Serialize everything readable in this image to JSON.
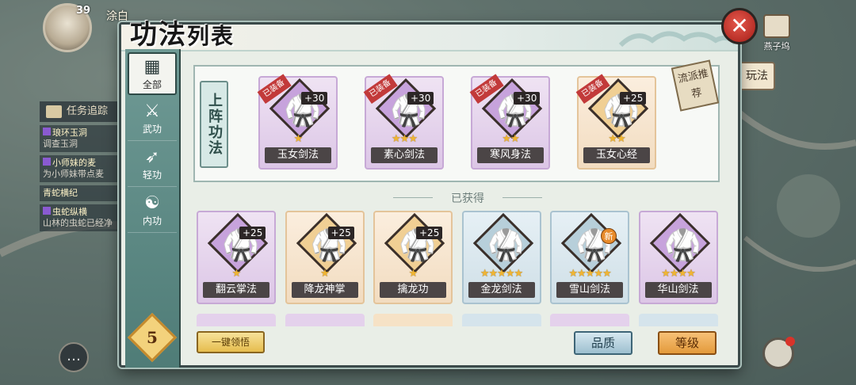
{
  "player": {
    "level": "39",
    "name": "涂白"
  },
  "hud": {
    "top_right_label": "燕子坞",
    "side_tab_label": "玩法",
    "quest_header": "任务追踪",
    "quests": [
      {
        "title": "琅环玉洞",
        "sub": "调查玉洞"
      },
      {
        "title": "小师妹的麦",
        "sub": "为小师妹带点麦"
      },
      {
        "title": "青蛇横纪",
        "sub": ""
      },
      {
        "title": "虫蛇纵横",
        "sub": "山林的虫蛇已经净"
      }
    ]
  },
  "dialog": {
    "title_main": "功法",
    "title_small": "列表",
    "close_label": "✕",
    "equipped_section_label": "上阵功法",
    "recommend_label": "流派推荐",
    "obtained_label": "已获得",
    "level_badge": "5",
    "buttons": {
      "claim_all": "一键领悟",
      "quality": "品质",
      "level": "等级"
    }
  },
  "sidebar": [
    {
      "label": "全部",
      "icon": "grid-icon",
      "glyph": "▦",
      "active": true
    },
    {
      "label": "武功",
      "icon": "sword-icon",
      "glyph": "⚔",
      "active": false
    },
    {
      "label": "轻功",
      "icon": "feather-icon",
      "glyph": "➶",
      "active": false
    },
    {
      "label": "内功",
      "icon": "meditation-icon",
      "glyph": "☯",
      "active": false
    }
  ],
  "equipped": [
    {
      "name": "玉女剑法",
      "bonus": "+30",
      "stars": "★",
      "tag": "已装备",
      "rarity": "purple"
    },
    {
      "name": "素心剑法",
      "bonus": "+30",
      "stars": "★★★",
      "tag": "已装备",
      "rarity": "purple"
    },
    {
      "name": "寒风身法",
      "bonus": "+30",
      "stars": "★★",
      "tag": "已装备",
      "rarity": "purple"
    },
    {
      "name": "玉女心经",
      "bonus": "+25",
      "stars": "★★",
      "tag": "已装备",
      "rarity": "orange"
    }
  ],
  "obtained": [
    {
      "name": "翻云掌法",
      "bonus": "+25",
      "stars": "★",
      "rarity": "purple",
      "new": ""
    },
    {
      "name": "降龙神掌",
      "bonus": "+25",
      "stars": "★",
      "rarity": "orange",
      "new": ""
    },
    {
      "name": "擒龙功",
      "bonus": "+25",
      "stars": "★",
      "rarity": "orange",
      "new": ""
    },
    {
      "name": "金龙剑法",
      "bonus": "",
      "stars": "★★★★★",
      "rarity": "blue",
      "new": ""
    },
    {
      "name": "雪山剑法",
      "bonus": "",
      "stars": "★★★★★",
      "rarity": "blue",
      "new": "新"
    },
    {
      "name": "华山剑法",
      "bonus": "",
      "stars": "★★★★",
      "rarity": "purple",
      "new": ""
    }
  ],
  "partial_row_rarities": [
    "purple",
    "purple",
    "orange",
    "blue",
    "purple",
    "blue"
  ],
  "colors": {
    "accent_teal": "#4f7c77",
    "close_red": "#b82f27",
    "gold": "#f0b533"
  }
}
